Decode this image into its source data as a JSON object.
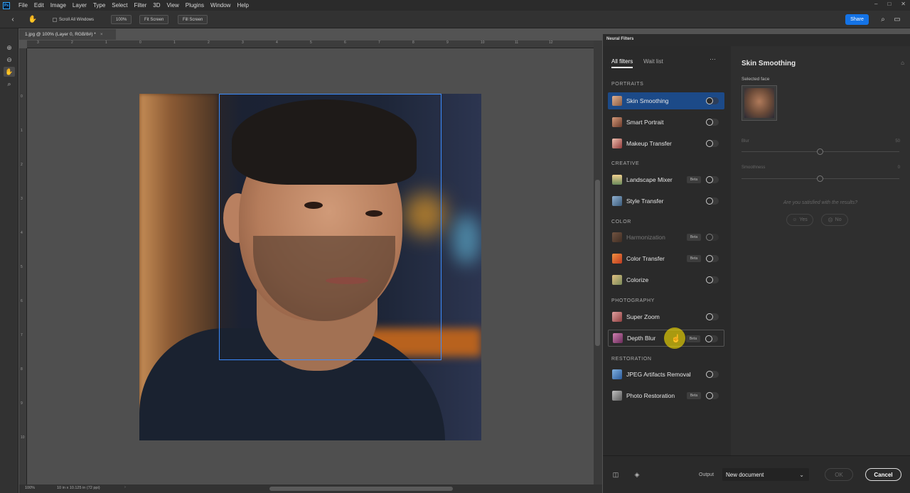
{
  "app": {
    "logo": "Ps",
    "menu": [
      "File",
      "Edit",
      "Image",
      "Layer",
      "Type",
      "Select",
      "Filter",
      "3D",
      "View",
      "Plugins",
      "Window",
      "Help"
    ],
    "window_controls": [
      "–",
      "□",
      "✕"
    ]
  },
  "options_bar": {
    "scroll_all_windows": "Scroll All Windows",
    "zoom_button": "100%",
    "fit_screen": "Fit Screen",
    "fill_screen": "Fill Screen",
    "share": "Share"
  },
  "document": {
    "tab_title": "1.jpg @ 100% (Layer 0, RGB/8#) *",
    "status_zoom": "100%",
    "status_info": "10 in x 10.125 in (72 ppi)"
  },
  "rulers": {
    "top": [
      "3",
      "2",
      "1",
      "0",
      "1",
      "2",
      "3",
      "4",
      "5",
      "6",
      "7",
      "8",
      "9",
      "10",
      "11",
      "12"
    ],
    "left": [
      "0",
      "1",
      "2",
      "3",
      "4",
      "5",
      "6",
      "7",
      "8",
      "9",
      "10"
    ]
  },
  "neural_filters": {
    "panel_title": "Neural Filters",
    "tabs": [
      "All filters",
      "Wait list"
    ],
    "more": "···",
    "sections": {
      "portraits": "PORTRAITS",
      "creative": "CREATIVE",
      "color": "COLOR",
      "photography": "PHOTOGRAPHY",
      "restoration": "RESTORATION"
    },
    "filters": {
      "skin_smoothing": {
        "label": "Skin Smoothing",
        "beta": ""
      },
      "smart_portrait": {
        "label": "Smart Portrait",
        "beta": ""
      },
      "makeup_transfer": {
        "label": "Makeup Transfer",
        "beta": ""
      },
      "landscape_mixer": {
        "label": "Landscape Mixer",
        "beta": "Beta"
      },
      "style_transfer": {
        "label": "Style Transfer",
        "beta": ""
      },
      "harmonization": {
        "label": "Harmonization",
        "beta": "Beta"
      },
      "color_transfer": {
        "label": "Color Transfer",
        "beta": "Beta"
      },
      "colorize": {
        "label": "Colorize",
        "beta": ""
      },
      "super_zoom": {
        "label": "Super Zoom",
        "beta": ""
      },
      "depth_blur": {
        "label": "Depth Blur",
        "beta": "Beta"
      },
      "jpeg_artifacts_removal": {
        "label": "JPEG Artifacts Removal",
        "beta": ""
      },
      "photo_restoration": {
        "label": "Photo Restoration",
        "beta": "Beta"
      }
    },
    "detail": {
      "title": "Skin Smoothing",
      "selected_face_label": "Selected face",
      "blur_label": "Blur",
      "blur_value": "50",
      "smoothness_label": "Smoothness",
      "smoothness_value": "0",
      "question": "Are you satisfied with the results?",
      "yes": "Yes",
      "no": "No"
    },
    "footer": {
      "output_label": "Output",
      "output_value": "New document",
      "ok": "OK",
      "cancel": "Cancel"
    }
  }
}
